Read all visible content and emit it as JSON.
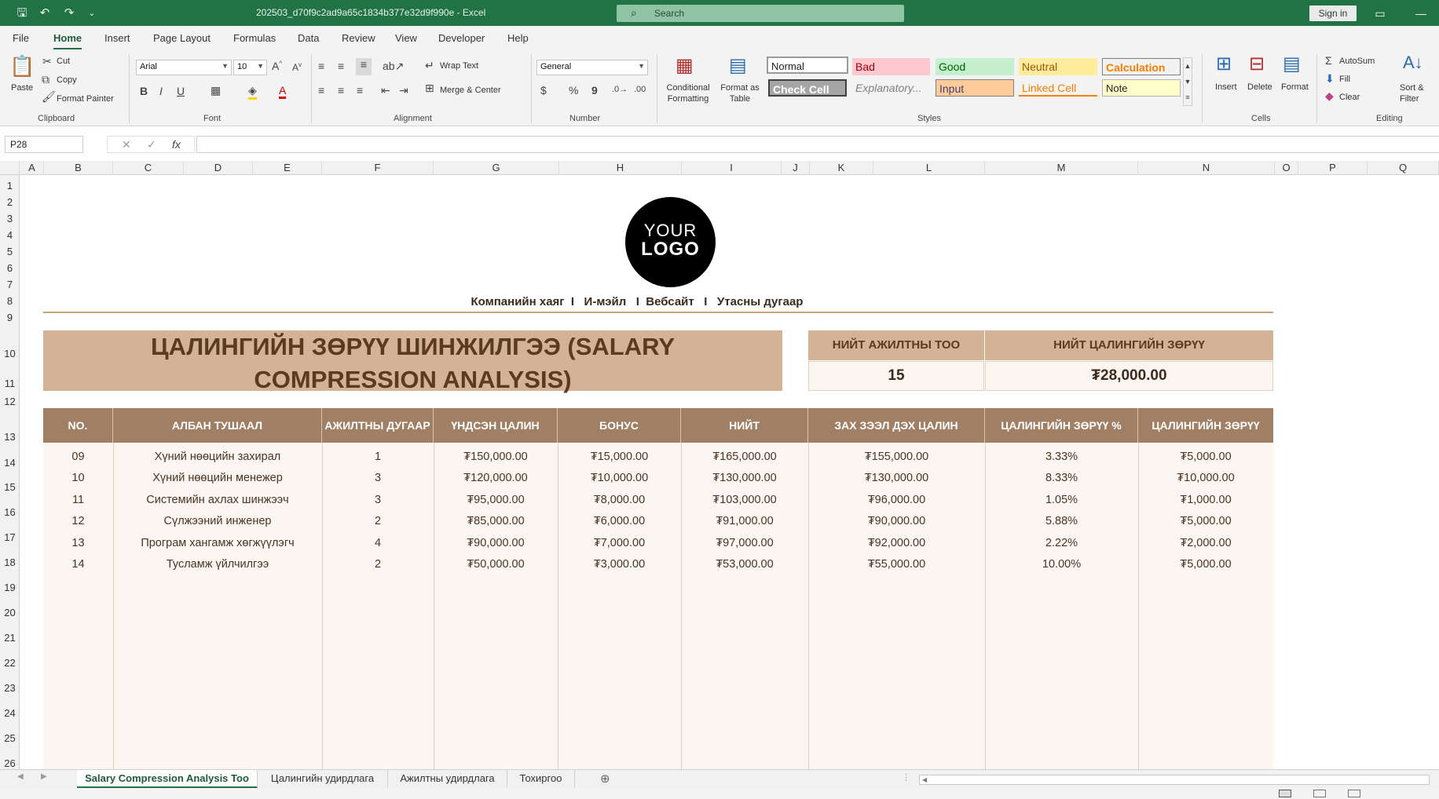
{
  "window": {
    "title": "202503_d70f9c2ad9a65c1834b377e32d9f990e  -  Excel",
    "search_placeholder": "Search",
    "signin": "Sign in"
  },
  "menu": [
    "File",
    "Home",
    "Insert",
    "Page Layout",
    "Formulas",
    "Data",
    "Review",
    "View",
    "Developer",
    "Help"
  ],
  "ribbon": {
    "clipboard": {
      "paste": "Paste",
      "cut": "Cut",
      "copy": "Copy",
      "format_painter": "Format Painter",
      "label": "Clipboard"
    },
    "font": {
      "name": "Arial",
      "size": "10",
      "label": "Font"
    },
    "alignment": {
      "wrap": "Wrap Text",
      "merge": "Merge & Center",
      "label": "Alignment"
    },
    "number": {
      "format": "General",
      "label": "Number"
    },
    "styles": {
      "conditional": "Conditional Formatting",
      "format_table": "Format as Table",
      "normal": "Normal",
      "bad": "Bad",
      "good": "Good",
      "neutral": "Neutral",
      "calculation": "Calculation",
      "check_cell": "Check Cell",
      "explanatory": "Explanatory...",
      "input": "Input",
      "linked_cell": "Linked Cell",
      "note": "Note",
      "label": "Styles"
    },
    "cells": {
      "insert": "Insert",
      "delete": "Delete",
      "format": "Format",
      "label": "Cells"
    },
    "editing": {
      "autosum": "AutoSum",
      "fill": "Fill",
      "clear": "Clear",
      "sort": "Sort & Filter",
      "label": "Editing"
    }
  },
  "formula_bar": {
    "name_box": "P28",
    "formula": ""
  },
  "columns": [
    "A",
    "B",
    "C",
    "D",
    "E",
    "F",
    "G",
    "H",
    "I",
    "J",
    "K",
    "L",
    "M",
    "N",
    "O",
    "P",
    "Q"
  ],
  "rows": [
    "1",
    "2",
    "3",
    "4",
    "5",
    "6",
    "7",
    "8",
    "9",
    "10",
    "11",
    "12",
    "13",
    "14",
    "15",
    "16",
    "17",
    "18",
    "19",
    "20",
    "21",
    "22",
    "23",
    "24",
    "25",
    "26"
  ],
  "sheet": {
    "logo_line1": "YOUR",
    "logo_line2": "LOGO",
    "contact": "Компанийн хаяг  I   И-мэйл   I  Вебсайт   I   Утасны дугаар",
    "title_line1": "ЦАЛИНГИЙН ЗӨРҮҮ ШИНЖИЛГЭЭ (SALARY",
    "title_line2": "COMPRESSION ANALYSIS)",
    "kpi_employees_label": "НИЙТ АЖИЛТНЫ ТОО",
    "kpi_employees_value": "15",
    "kpi_gap_label": "НИЙТ ЦАЛИНГИЙН ЗӨРҮҮ",
    "kpi_gap_value": "₮28,000.00",
    "headers": [
      "NO.",
      "АЛБАН ТУШААЛ",
      "АЖИЛТНЫ ДУГААР",
      "ҮНДСЭН ЦАЛИН",
      "БОНУС",
      "НИЙТ",
      "ЗАХ ЗЭЭЛ ДЭХ ЦАЛИН",
      "ЦАЛИНГИЙН ЗӨРҮҮ %",
      "ЦАЛИНГИЙН ЗӨРҮҮ"
    ],
    "rows": [
      [
        "09",
        "Хүний нөөцийн захирал",
        "1",
        "₮150,000.00",
        "₮15,000.00",
        "₮165,000.00",
        "₮155,000.00",
        "3.33%",
        "₮5,000.00"
      ],
      [
        "10",
        "Хүний нөөцийн менежер",
        "3",
        "₮120,000.00",
        "₮10,000.00",
        "₮130,000.00",
        "₮130,000.00",
        "8.33%",
        "₮10,000.00"
      ],
      [
        "11",
        "Системийн ахлах шинжээч",
        "3",
        "₮95,000.00",
        "₮8,000.00",
        "₮103,000.00",
        "₮96,000.00",
        "1.05%",
        "₮1,000.00"
      ],
      [
        "12",
        "Сүлжээний инженер",
        "2",
        "₮85,000.00",
        "₮6,000.00",
        "₮91,000.00",
        "₮90,000.00",
        "5.88%",
        "₮5,000.00"
      ],
      [
        "13",
        "Програм хангамж хөгжүүлэгч",
        "4",
        "₮90,000.00",
        "₮7,000.00",
        "₮97,000.00",
        "₮92,000.00",
        "2.22%",
        "₮2,000.00"
      ],
      [
        "14",
        "Тусламж үйлчилгээ",
        "2",
        "₮50,000.00",
        "₮3,000.00",
        "₮53,000.00",
        "₮55,000.00",
        "10.00%",
        "₮5,000.00"
      ]
    ]
  },
  "tabs": [
    "Salary Compression Analysis Too",
    "Цалингийн удирдлага",
    "Ажилтны удирдлага",
    "Тохиргоо"
  ],
  "colors": {
    "excel_green": "#217346",
    "header_brown": "#a17f64",
    "title_tan": "#d4b295",
    "body_cream": "#fbf6f1"
  }
}
